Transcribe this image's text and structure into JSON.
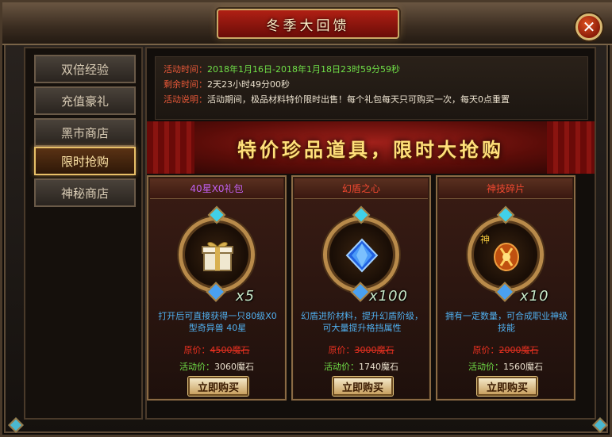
{
  "window": {
    "title": "冬季大回馈",
    "close_glyph": "✕"
  },
  "sidebar": {
    "items": [
      {
        "label": "双倍经验",
        "active": false
      },
      {
        "label": "充值豪礼",
        "active": false
      },
      {
        "label": "黑市商店",
        "active": false
      },
      {
        "label": "限时抢购",
        "active": true
      },
      {
        "label": "神秘商店",
        "active": false
      }
    ]
  },
  "info": {
    "time_label": "活动时间：",
    "time_value": "2018年1月16日-2018年1月18日23时59分59秒",
    "remain_label": "剩余时间：",
    "remain_value": "2天23小时49分00秒",
    "desc_label": "活动说明：",
    "desc_value": "活动期间，极品材料特价限时出售！每个礼包每天只可购买一次，每天0点重置"
  },
  "banner": {
    "text": "特价珍品道具，限时大抢购"
  },
  "cards": [
    {
      "name": "40星X0礼包",
      "name_color": "#c060f0",
      "icon": "gift-box-icon",
      "quantity": "x5",
      "description": "打开后可直接获得一只80级X0型奇异兽 40星",
      "original_label": "原价：",
      "original_price": "4500魔石",
      "activity_label": "活动价：",
      "activity_price": "3060魔石",
      "buy_label": "立即购买"
    },
    {
      "name": "幻盾之心",
      "name_color": "#f04830",
      "icon": "blue-gem-icon",
      "quantity": "x100",
      "description": "幻盾进阶材料，提升幻盾阶级，可大量提升格挡属性",
      "original_label": "原价：",
      "original_price": "3000魔石",
      "activity_label": "活动价：",
      "activity_price": "1740魔石",
      "buy_label": "立即购买"
    },
    {
      "name": "神技碎片",
      "name_color": "#f04830",
      "icon": "skill-fragment-icon",
      "badge": "神",
      "quantity": "x10",
      "description": "拥有一定数量，可合成职业神级技能",
      "original_label": "原价：",
      "original_price": "2000魔石",
      "activity_label": "活动价：",
      "activity_price": "1560魔石",
      "buy_label": "立即购买"
    }
  ]
}
